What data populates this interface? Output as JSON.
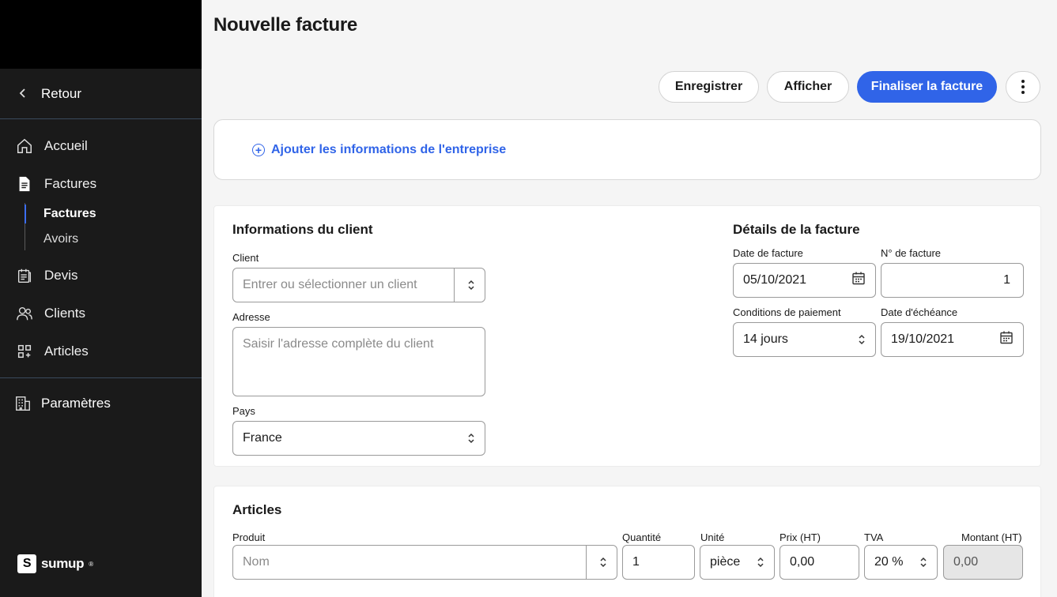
{
  "sidebar": {
    "back_label": "Retour",
    "items": [
      {
        "label": "Accueil",
        "icon": "home-icon"
      },
      {
        "label": "Factures",
        "icon": "document-icon"
      },
      {
        "label": "Devis",
        "icon": "quote-icon"
      },
      {
        "label": "Clients",
        "icon": "users-icon"
      },
      {
        "label": "Articles",
        "icon": "grid-plus-icon"
      }
    ],
    "sub_items": [
      {
        "label": "Factures",
        "active": true
      },
      {
        "label": "Avoirs",
        "active": false
      }
    ],
    "settings_label": "Paramètres",
    "logo_text": "sumup",
    "logo_mark": "S",
    "logo_reg": "®"
  },
  "header": {
    "title": "Nouvelle facture"
  },
  "toolbar": {
    "save_label": "Enregistrer",
    "view_label": "Afficher",
    "finalize_label": "Finaliser la facture"
  },
  "company": {
    "add_label": "Ajouter les informations de l'entreprise"
  },
  "client_info": {
    "title": "Informations du client",
    "client_label": "Client",
    "client_placeholder": "Entrer ou sélectionner un client",
    "address_label": "Adresse",
    "address_placeholder": "Saisir l'adresse complète du client",
    "country_label": "Pays",
    "country_value": "France"
  },
  "invoice_details": {
    "title": "Détails de la facture",
    "date_label": "Date de facture",
    "date_value": "05/10/2021",
    "number_label": "N° de facture",
    "number_value": "1",
    "terms_label": "Conditions de paiement",
    "terms_value": "14 jours",
    "due_label": "Date d'échéance",
    "due_value": "19/10/2021"
  },
  "articles": {
    "title": "Articles",
    "columns": {
      "product": "Produit",
      "quantity": "Quantité",
      "unit": "Unité",
      "price": "Prix (HT)",
      "vat": "TVA",
      "amount": "Montant (HT)"
    },
    "row": {
      "product_placeholder": "Nom",
      "quantity": "1",
      "unit": "pièce",
      "price": "0,00",
      "vat": "20 %",
      "amount": "0,00"
    }
  },
  "colors": {
    "accent": "#3064e8",
    "sidebar_bg": "#1a1a1a"
  }
}
